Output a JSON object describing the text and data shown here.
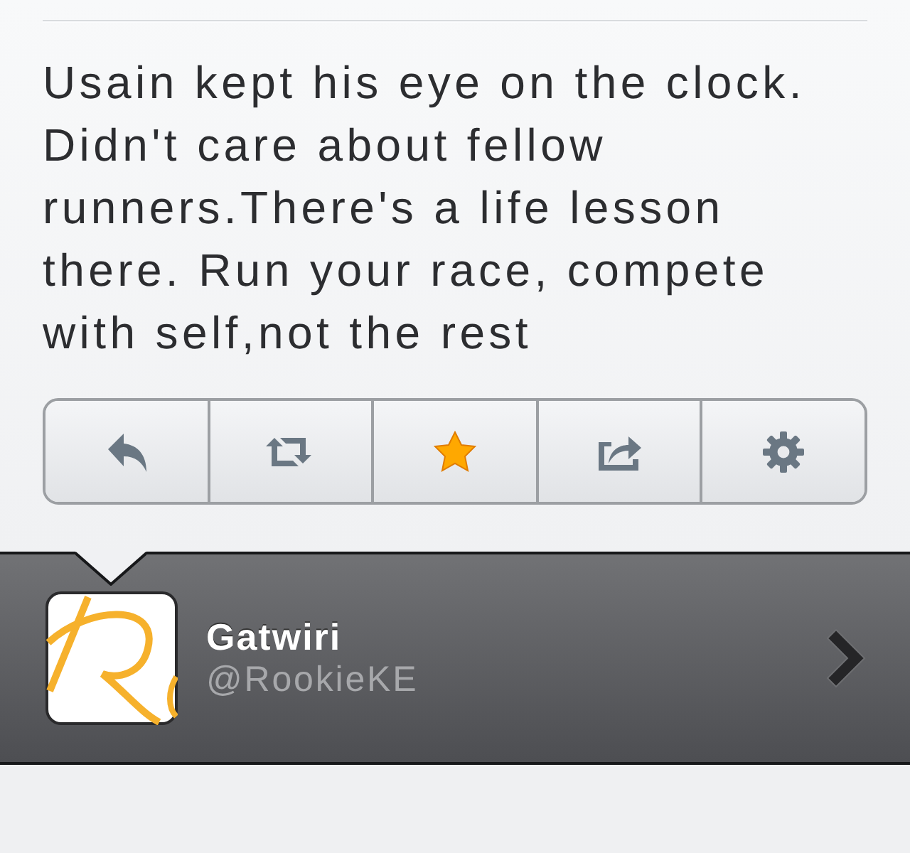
{
  "tweet": {
    "text": "Usain kept his eye on the clock. Didn't care about fellow runners.There's a life lesson there. Run your race, compete with self,not the rest"
  },
  "actions": [
    {
      "kind": "reply",
      "on": false
    },
    {
      "kind": "retweet",
      "on": false
    },
    {
      "kind": "favorite",
      "on": true
    },
    {
      "kind": "share",
      "on": false
    },
    {
      "kind": "settings",
      "on": false
    }
  ],
  "author": {
    "name": "Gatwiri",
    "handle": "@RookieKE"
  }
}
